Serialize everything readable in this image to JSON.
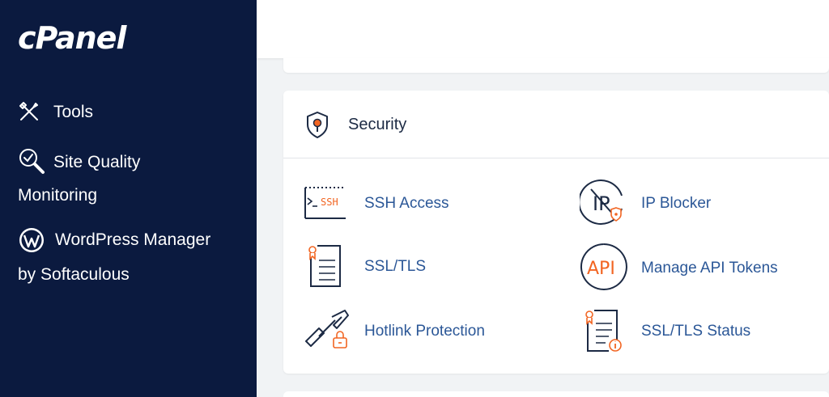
{
  "brand": {
    "logo_text": "cPanel"
  },
  "sidebar": {
    "items": [
      {
        "line1": "Tools",
        "line2": "",
        "icon": "tools-icon"
      },
      {
        "line1": "Site Quality",
        "line2": "Monitoring",
        "icon": "magnifier-check-icon"
      },
      {
        "line1": "WordPress Manager",
        "line2": "by Softaculous",
        "icon": "wordpress-icon"
      }
    ]
  },
  "security": {
    "title": "Security",
    "icon": "shield-icon",
    "tools": [
      {
        "label": "SSH Access",
        "icon": "ssh-terminal-icon",
        "icon_text": "SSH"
      },
      {
        "label": "IP Blocker",
        "icon": "ip-blocker-icon",
        "icon_text": "IP"
      },
      {
        "label": "SSL/TLS",
        "icon": "certificate-icon"
      },
      {
        "label": "Manage API Tokens",
        "icon": "api-icon",
        "icon_text": "API"
      },
      {
        "label": "Hotlink Protection",
        "icon": "hotlink-chain-icon"
      },
      {
        "label": "SSL/TLS Status",
        "icon": "certificate-status-icon"
      }
    ]
  },
  "colors": {
    "sidebar_bg": "#0b1a3f",
    "link": "#2b5797",
    "accent": "#f26522",
    "page_bg": "#f1f3f5"
  }
}
